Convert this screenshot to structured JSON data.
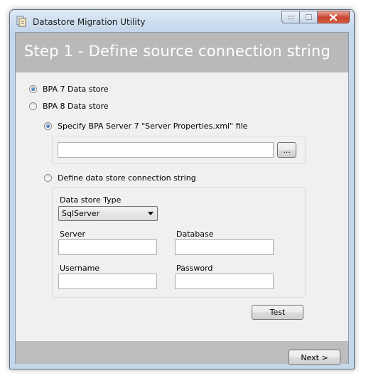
{
  "window": {
    "title": "Datastore Migration Utility",
    "icons": {
      "app": "migration-app-icon",
      "minimize": "minimize-icon",
      "maximize": "maximize-icon",
      "close": "close-icon"
    }
  },
  "header": {
    "title": "Step 1 - Define source connection string"
  },
  "source": {
    "bpa7_label": "BPA 7 Data store",
    "bpa7_selected": true,
    "bpa8_label": "BPA 8 Data store",
    "bpa8_selected": false
  },
  "bpa7_options": {
    "server_properties_label": "Specify BPA Server 7 \"Server Properties.xml\" file",
    "server_properties_selected": true,
    "file_path_value": "",
    "browse_label": "...",
    "connection_string_label": "Define data store connection string",
    "connection_string_selected": false
  },
  "connection": {
    "type_label": "Data store Type",
    "type_value": "SqlServer",
    "server_label": "Server",
    "server_value": "",
    "database_label": "Database",
    "database_value": "",
    "username_label": "Username",
    "username_value": "",
    "password_label": "Password",
    "password_value": ""
  },
  "actions": {
    "test_label": "Test",
    "next_label": "Next >"
  }
}
